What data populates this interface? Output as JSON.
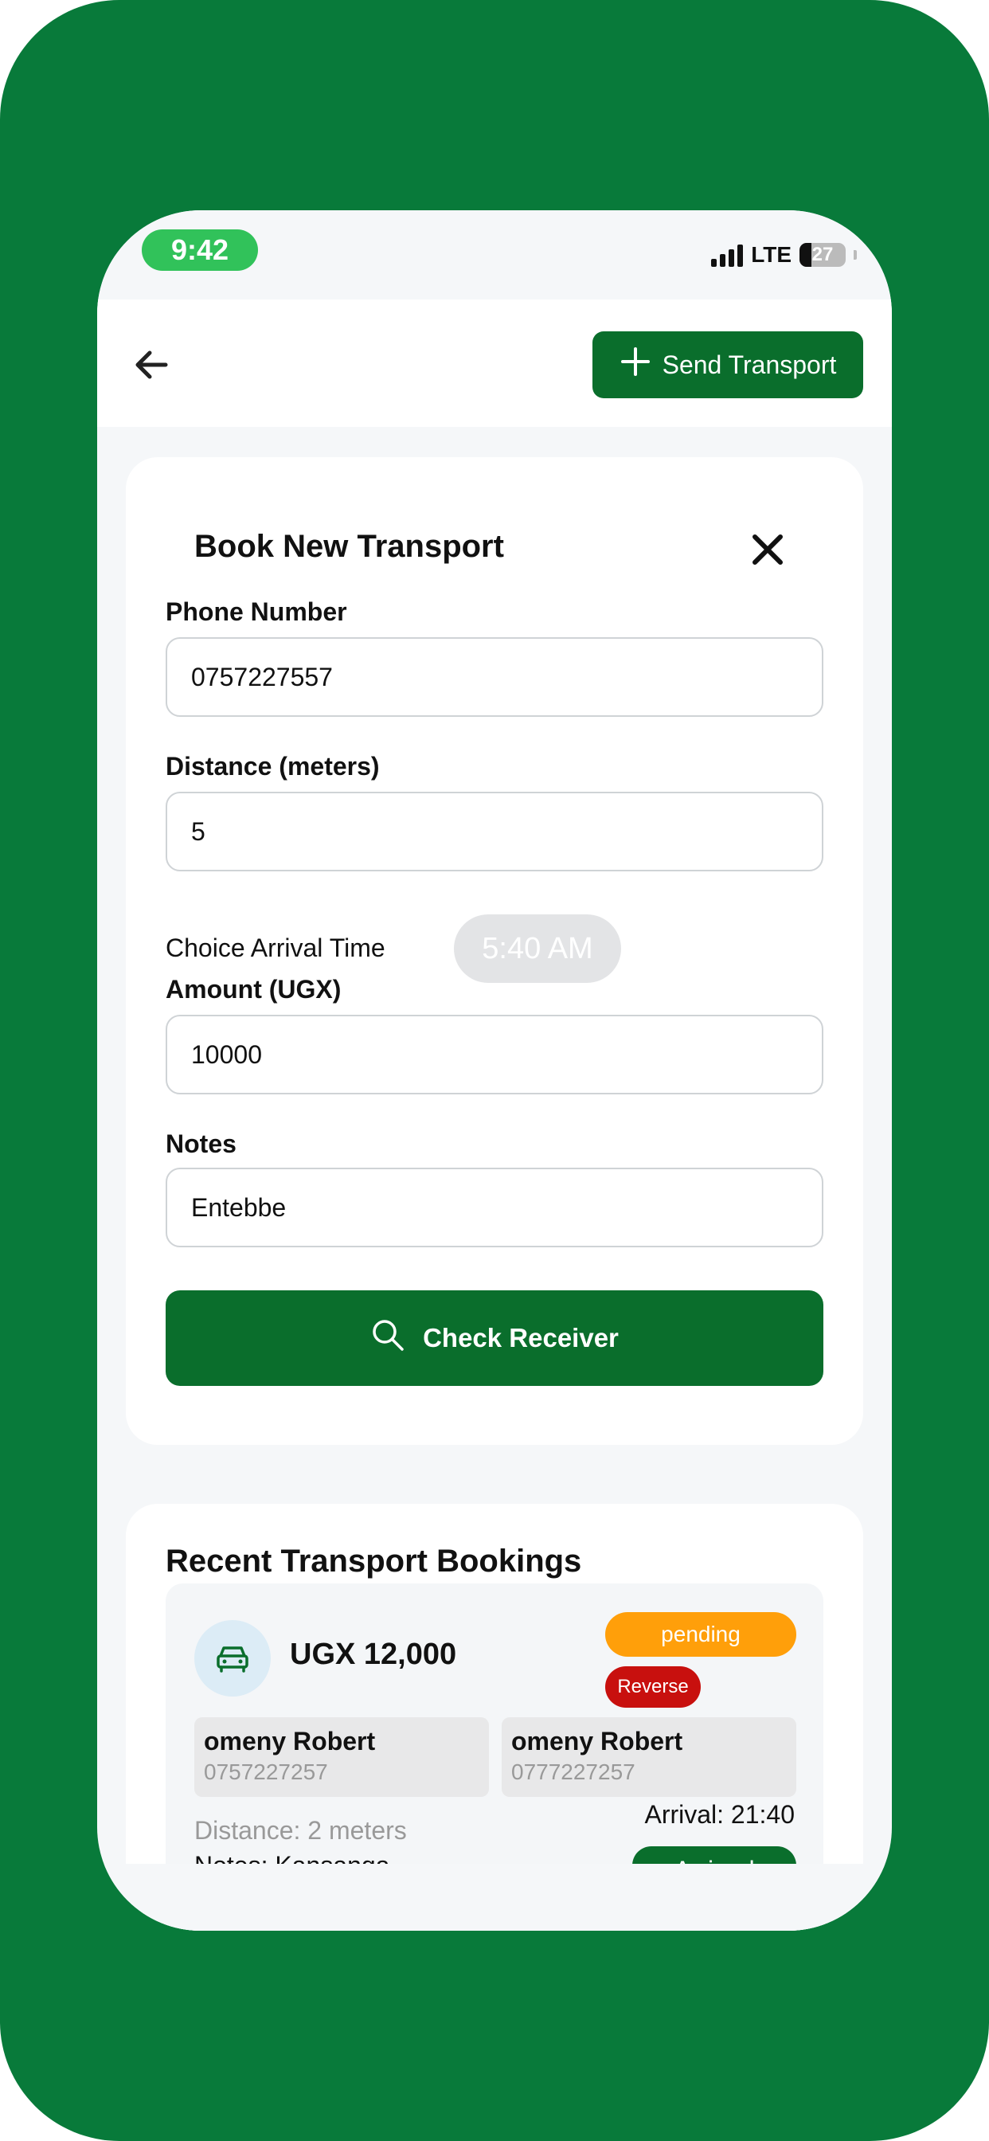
{
  "status_bar": {
    "time": "9:42",
    "network": "LTE",
    "battery": "27"
  },
  "header": {
    "send_transport_label": "Send Transport"
  },
  "form": {
    "title": "Book New Transport",
    "phone_label": "Phone Number",
    "phone_value": "0757227557",
    "distance_label": "Distance (meters)",
    "distance_value": "5",
    "arrival_label": "Choice Arrival Time",
    "arrival_value": "5:40 AM",
    "amount_label": "Amount (UGX)",
    "amount_value": "10000",
    "notes_label": "Notes",
    "notes_value": "Entebbe",
    "check_button": "Check Receiver"
  },
  "recent": {
    "title": "Recent Transport Bookings",
    "bookings": [
      {
        "amount": "UGX 12,000",
        "status": "pending",
        "type": "Reverse",
        "sender": {
          "name": "omeny Robert",
          "phone": "0757227257"
        },
        "receiver": {
          "name": "omeny Robert",
          "phone": "0777227257"
        },
        "distance": "Distance: 2 meters",
        "notes": "Notes: Kansanga",
        "arrival": "Arrival: 21:40",
        "arrived_label": "Arrived"
      }
    ]
  },
  "colors": {
    "background_green": "#087a3a",
    "primary_green": "#0a6e2c",
    "pending": "#ff9f0a",
    "reverse": "#c8100e",
    "time_pill": "#31c25a"
  },
  "icons": [
    "back-arrow-icon",
    "plus-icon",
    "close-icon",
    "search-icon",
    "car-icon"
  ]
}
